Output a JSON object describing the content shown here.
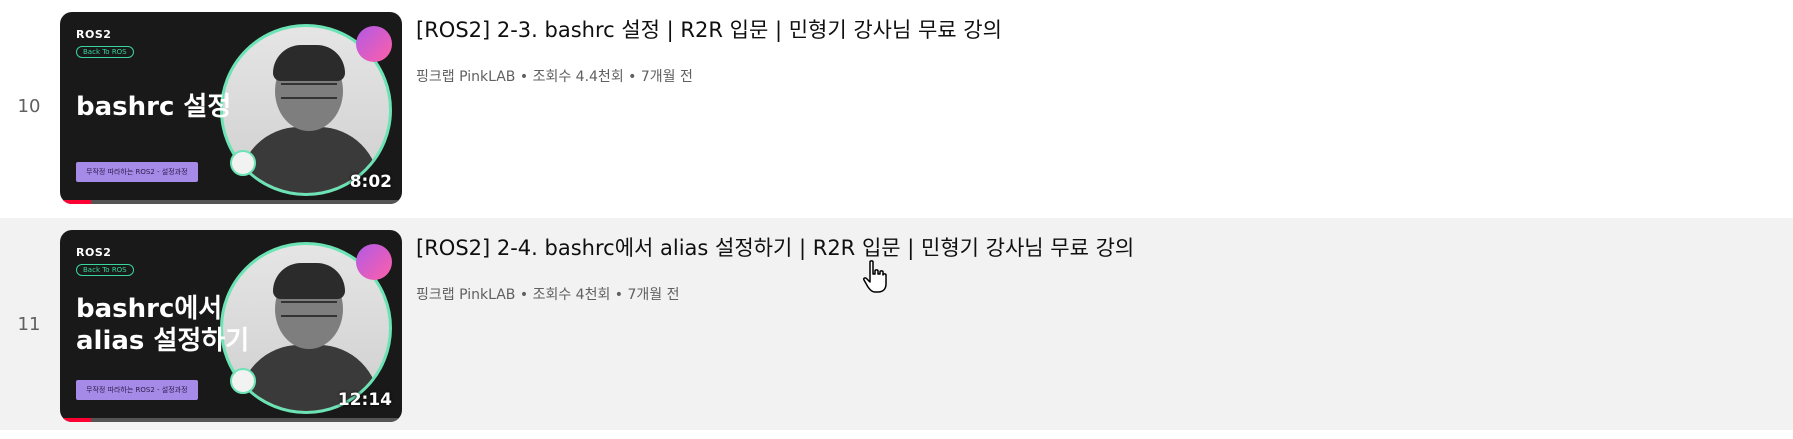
{
  "playlist": {
    "items": [
      {
        "index": "10",
        "title": "[ROS2] 2-3. bashrc 설정 | R2R 입문 | 민형기 강사님 무료 강의",
        "channel": "핑크랩 PinkLAB",
        "views": "조회수 4.4천회",
        "age": "7개월 전",
        "separator": " • ",
        "duration": "8:02",
        "watched_fraction": 0.09,
        "thumb": {
          "logo": "ROS2",
          "pill": "Back To ROS",
          "title_lines": [
            "bashrc 설정"
          ],
          "tag": "무작정 따라하는 ROS2 - 설정과정"
        }
      },
      {
        "index": "11",
        "title": "[ROS2] 2-4. bashrc에서 alias 설정하기 | R2R 입문 | 민형기 강사님 무료 강의",
        "channel": "핑크랩 PinkLAB",
        "views": "조회수 4천회",
        "age": "7개월 전",
        "separator": " • ",
        "duration": "12:14",
        "watched_fraction": 0.09,
        "thumb": {
          "logo": "ROS2",
          "pill": "Back To ROS",
          "title_lines": [
            "bashrc에서",
            "alias 설정하기"
          ],
          "tag": "무작정 따라하는 ROS2 - 설정과정"
        }
      }
    ]
  },
  "colors": {
    "accent_red": "#ff0033",
    "mint_ring": "#6ce3b5",
    "hover_bg": "#f2f2f2"
  }
}
